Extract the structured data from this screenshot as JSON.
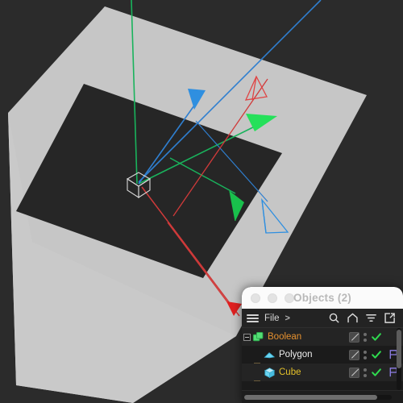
{
  "viewport": {
    "name": "3d-viewport",
    "background_color": "#2b2b2b",
    "plane_color": "#c6c6c6",
    "hole_color": "#262626",
    "axis_colors": {
      "x": "#d03a3a",
      "y": "#19b35c",
      "z": "#2f7fd0"
    },
    "gizmo_label": "origin-cube",
    "normals": [
      {
        "name": "normal-cone-blue-filled",
        "color": "#2f8fe0"
      },
      {
        "name": "normal-cone-red-wire",
        "color": "#e04545"
      },
      {
        "name": "normal-cone-green-filled-upper",
        "color": "#25e05a"
      },
      {
        "name": "normal-cone-green-filled-lower",
        "color": "#19c04c"
      },
      {
        "name": "normal-cone-blue-wire",
        "color": "#2f8fe0"
      },
      {
        "name": "normal-cone-red-filled",
        "color": "#e02020"
      }
    ]
  },
  "panel": {
    "title": "Objects (2)",
    "traffic_lights": [
      "close",
      "minimize",
      "zoom"
    ],
    "toolbar": {
      "menu_label": "File",
      "chevron_label": ">",
      "icons": [
        "search-icon",
        "home-icon",
        "filter-icon",
        "open-external-icon"
      ]
    },
    "columns": [
      "name",
      "tag",
      "options",
      "visibility",
      "flag"
    ],
    "rows": [
      {
        "name": "Boolean",
        "icon": "boolean-icon",
        "name_color": "#e6912f",
        "depth": 0,
        "expanded": true,
        "tag": "tag-box",
        "options": "options-dots",
        "visible": true,
        "flag": false
      },
      {
        "name": "Polygon",
        "icon": "polygon-icon",
        "name_color": "#ededed",
        "depth": 1,
        "expanded": null,
        "tag": "tag-box",
        "options": "options-dots",
        "visible": true,
        "flag": true
      },
      {
        "name": "Cube",
        "icon": "cube-icon",
        "name_color": "#e4c12a",
        "depth": 1,
        "expanded": null,
        "tag": "tag-box",
        "options": "options-dots",
        "visible": true,
        "flag": true
      }
    ],
    "scrollbars": {
      "vertical": true,
      "horizontal": true
    }
  }
}
